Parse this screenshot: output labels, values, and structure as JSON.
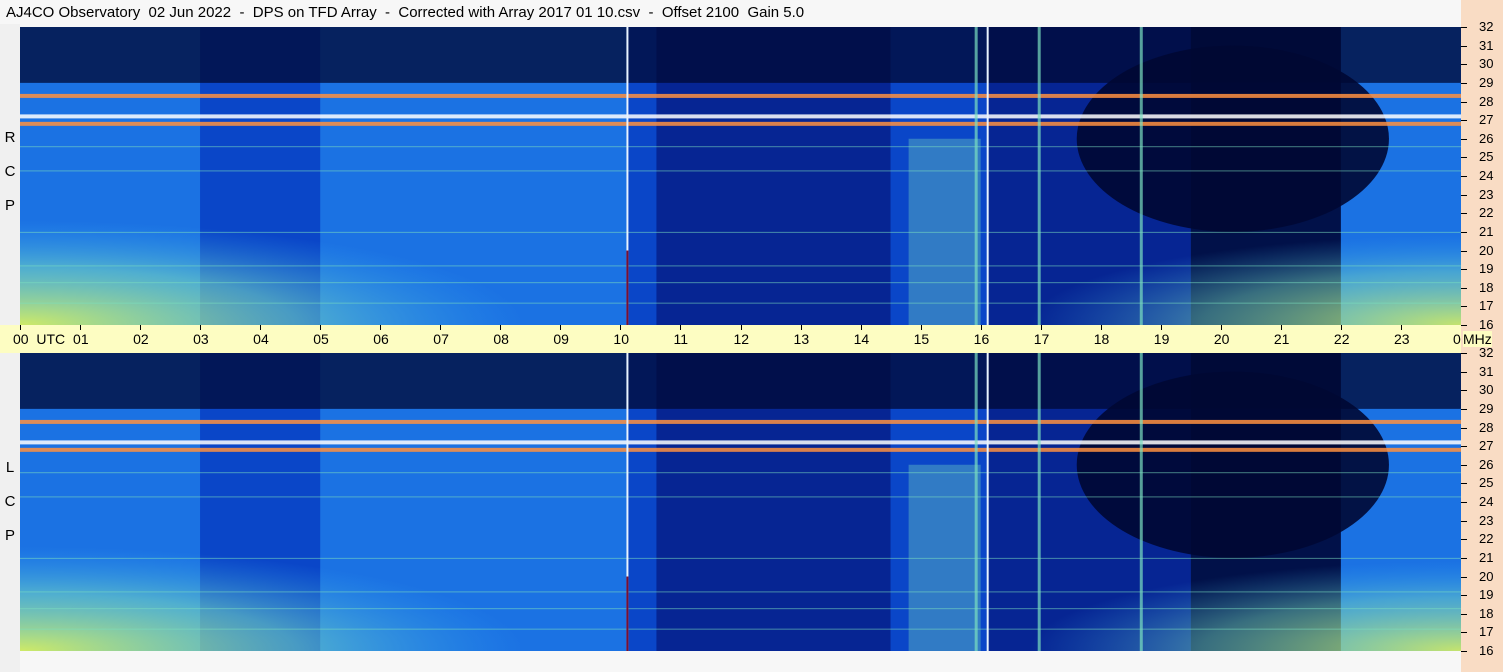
{
  "header": {
    "title": "AJ4CO Observatory  02 Jun 2022  -  DPS on TFD Array  -  Corrected with Array 2017 01 10.csv  -  Offset 2100  Gain 5.0"
  },
  "polarizations": {
    "rcp": [
      "R",
      "C",
      "P"
    ],
    "lcp": [
      "L",
      "C",
      "P"
    ]
  },
  "chart_data": {
    "type": "heatmap",
    "title": "AJ4CO Observatory  02 Jun 2022  -  DPS on TFD Array  -  Corrected with Array 2017 01 10.csv  -  Offset 2100  Gain 5.0",
    "x_axis": {
      "unit_label": "UTC",
      "range": [
        0,
        24
      ],
      "ticks": [
        "00",
        "01",
        "02",
        "03",
        "04",
        "05",
        "06",
        "07",
        "08",
        "09",
        "10",
        "11",
        "12",
        "13",
        "14",
        "15",
        "16",
        "17",
        "18",
        "19",
        "20",
        "21",
        "22",
        "23",
        "00"
      ]
    },
    "y_axis": {
      "unit_label": "MHz",
      "range": [
        16,
        32
      ],
      "ticks": [
        "32",
        "31",
        "30",
        "29",
        "28",
        "27",
        "26",
        "25",
        "24",
        "23",
        "22",
        "21",
        "20",
        "19",
        "18",
        "17",
        "16"
      ]
    },
    "panels": [
      {
        "name": "RCP",
        "polarization": "R C P"
      },
      {
        "name": "LCP",
        "polarization": "L C P"
      }
    ],
    "colormap": [
      "#000833",
      "#06208a",
      "#0a46c8",
      "#1e7ae8",
      "#3ab4f0",
      "#7be0c0",
      "#d8f060",
      "#ff9040",
      "#ff40c0",
      "#ffffff"
    ],
    "grid": false,
    "legend": "none",
    "features": {
      "interference_bands_mhz": [
        28.3,
        27.2,
        26.8
      ],
      "vertical_lines_utc": [
        10.1,
        16.1
      ],
      "vertical_streaks_utc": [
        15.9,
        16.95,
        18.65
      ]
    }
  }
}
